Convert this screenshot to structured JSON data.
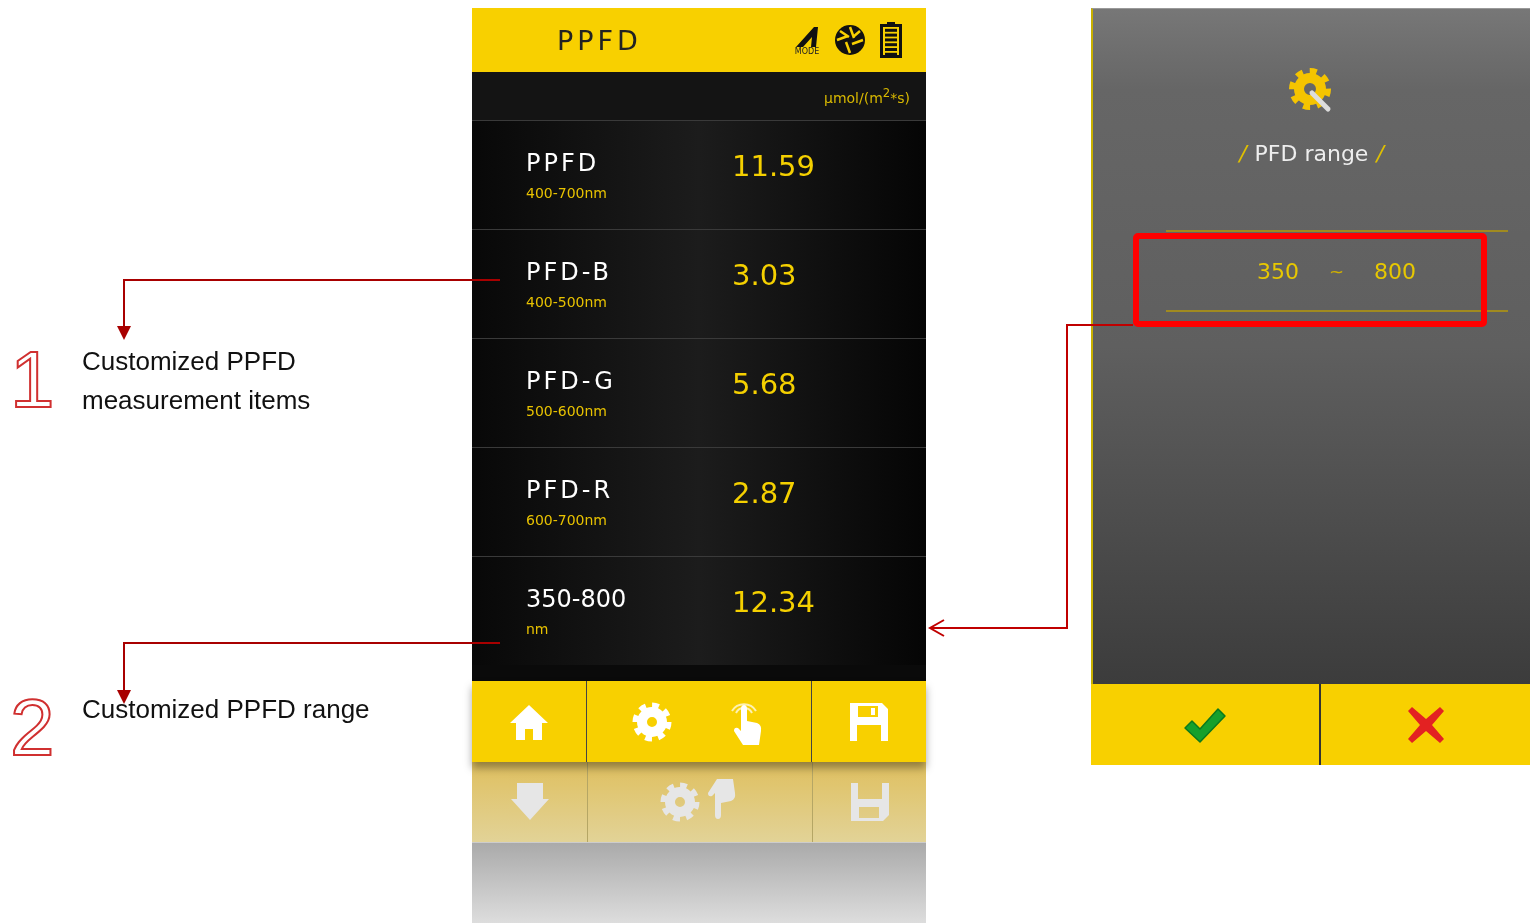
{
  "annotations": [
    {
      "number": "1",
      "text": "Customized PPFD measurement items"
    },
    {
      "number": "2",
      "text": "Customized PPFD range"
    }
  ],
  "phone": {
    "title": "PPFD",
    "mode_label": "MODE",
    "unit": "µmol/(m$^{2}$*s)",
    "rows": [
      {
        "name": "PPFD",
        "range": "400-700nm",
        "value": "11.59"
      },
      {
        "name": "PFD-B",
        "range": "400-500nm",
        "value": "3.03"
      },
      {
        "name": "PFD-G",
        "range": "500-600nm",
        "value": "5.68"
      },
      {
        "name": "PFD-R",
        "range": "600-700nm",
        "value": "2.87"
      },
      {
        "name": "350-800",
        "range": "nm",
        "value": "12.34"
      }
    ]
  },
  "settings": {
    "title_mark_left": "/",
    "title": "PFD range",
    "title_mark_right": "/",
    "range_from": "350",
    "separator": "~",
    "range_to": "800"
  }
}
